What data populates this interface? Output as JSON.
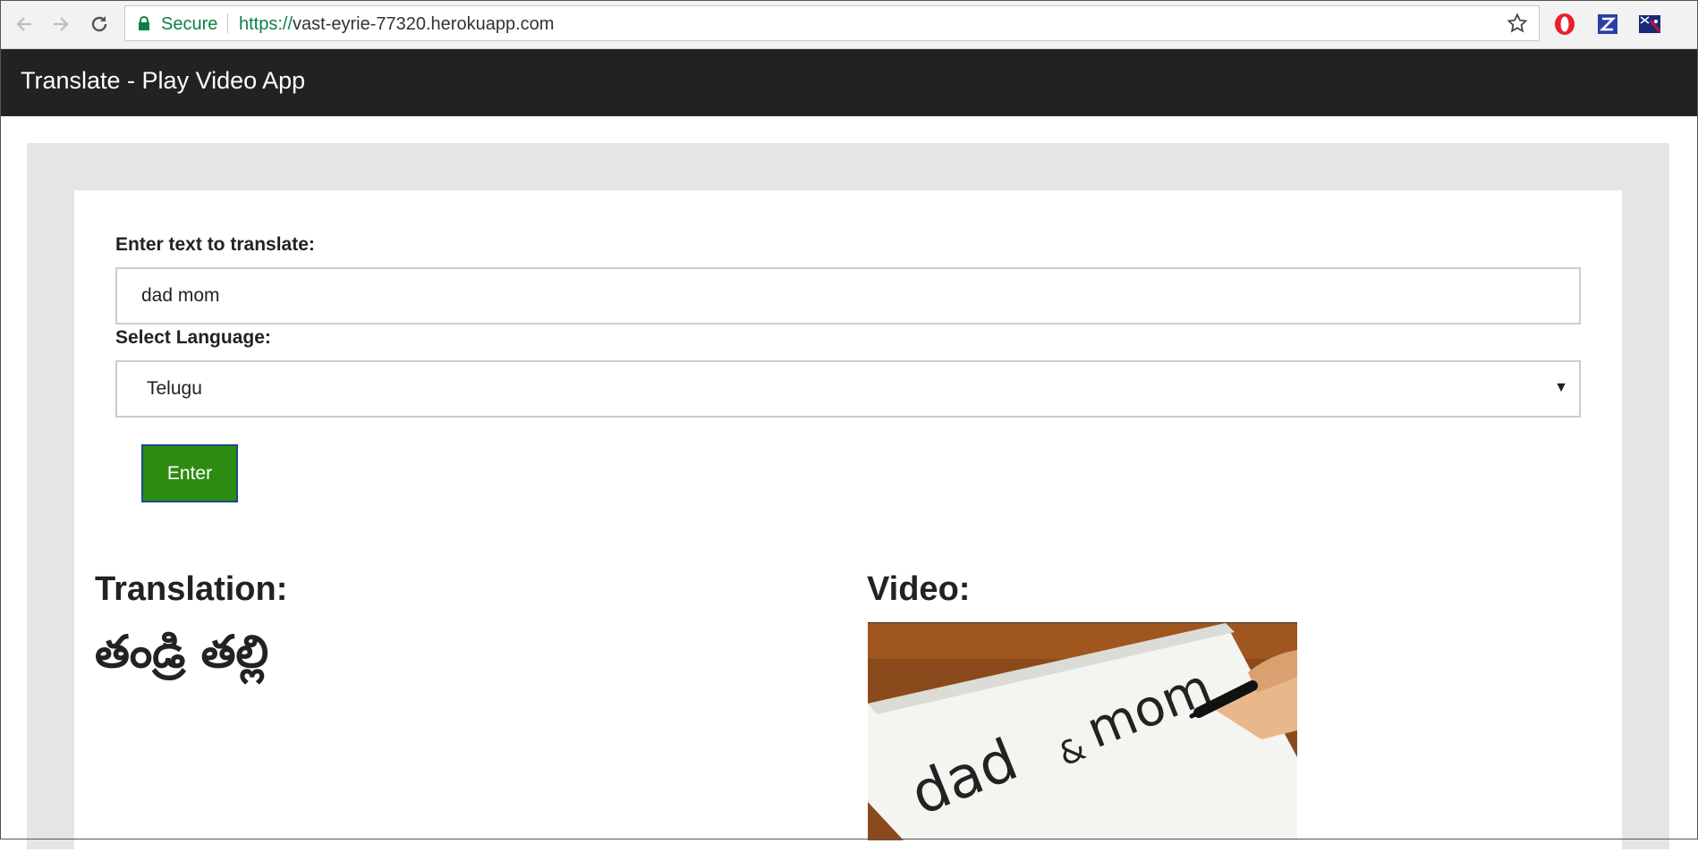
{
  "browser": {
    "secure_label": "Secure",
    "url_scheme": "https://",
    "url_host": "vast-eyrie-77320.herokuapp.com"
  },
  "navbar": {
    "title": "Translate - Play Video App"
  },
  "form": {
    "text_label": "Enter text to translate:",
    "text_value": "dad mom",
    "language_label": "Select Language:",
    "language_selected": "Telugu",
    "submit_label": "Enter"
  },
  "results": {
    "translation_heading": "Translation:",
    "translation_text": "తండ్రి తల్లి",
    "video_heading": "Video:",
    "video_thumbnail_text_1": "dad",
    "video_thumbnail_text_2": "&",
    "video_thumbnail_text_3": "mom"
  },
  "colors": {
    "navbar_bg": "#222222",
    "button_bg": "#2e8b12",
    "page_bg": "#e5e5e5",
    "secure_green": "#0b8043"
  },
  "icons": [
    "back-arrow-icon",
    "forward-arrow-icon",
    "reload-icon",
    "lock-icon",
    "star-icon",
    "opera-extension-icon",
    "zotero-extension-icon",
    "flag-extension-icon",
    "dropdown-arrow-icon"
  ]
}
